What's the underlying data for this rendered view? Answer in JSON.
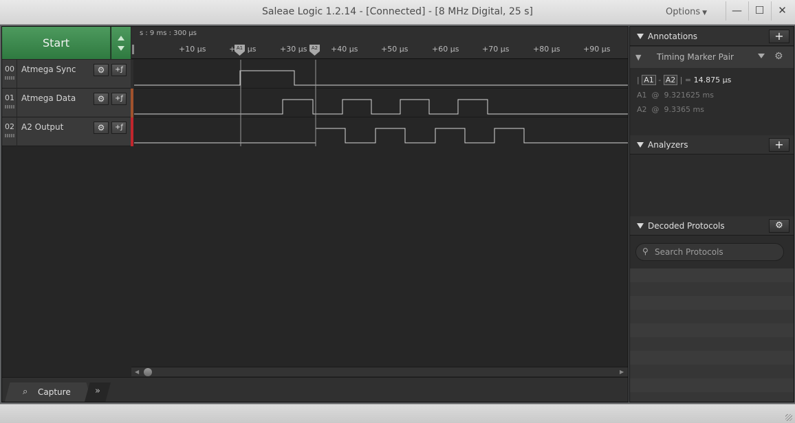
{
  "window": {
    "title": "Saleae Logic 1.2.14 - [Connected] - [8 MHz Digital, 25 s]",
    "options_label": "Options",
    "minimize": "—",
    "maximize": "☐",
    "close": "✕"
  },
  "toolbar": {
    "start_label": "Start"
  },
  "ruler": {
    "offset": "s : 9 ms : 300 µs",
    "ticks": [
      "+10 µs",
      "+20 µs",
      "+30 µs",
      "+40 µs",
      "+50 µs",
      "+60 µs",
      "+70 µs",
      "+80 µs",
      "+90 µs"
    ],
    "marker_a1": "A1",
    "marker_a2": "A2"
  },
  "channels": [
    {
      "num": "00",
      "name": "Atmega Sync",
      "color": "#2f2f2f"
    },
    {
      "num": "01",
      "name": "Atmega Data",
      "color": "#a0522d"
    },
    {
      "num": "02",
      "name": "A2 Output",
      "color": "#c0262d"
    }
  ],
  "bottom": {
    "capture_label": "Capture",
    "more": "»"
  },
  "annotations": {
    "title": "Annotations",
    "add": "+",
    "timing_label": "Timing Marker Pair",
    "diff_a": "A1",
    "diff_b": "A2",
    "diff_value": "14.875 µs",
    "a1_label": "A1",
    "a1_value": "9.321625 ms",
    "a2_label": "A2",
    "a2_value": "9.3365 ms"
  },
  "analyzers": {
    "title": "Analyzers",
    "add": "+"
  },
  "decoded": {
    "title": "Decoded Protocols",
    "settings": "⚙",
    "search_placeholder": "Search Protocols"
  }
}
